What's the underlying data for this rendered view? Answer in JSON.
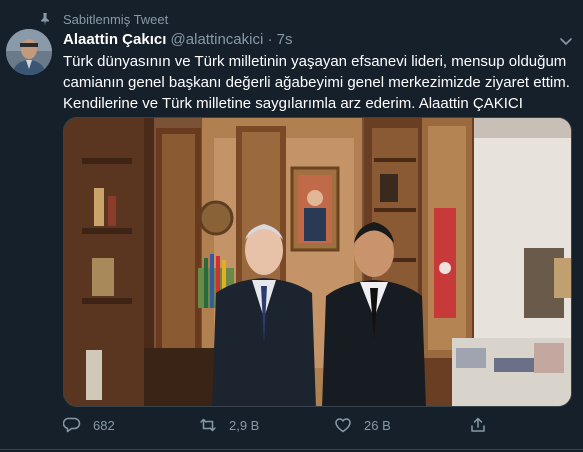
{
  "pinned": {
    "label": "Sabitlenmiş Tweet"
  },
  "author": {
    "name": "Alaattin Çakıcı",
    "handle": "@alattincakici",
    "separator": "·",
    "time": "7s"
  },
  "tweet": {
    "lines": [
      "Türk dünyasının ve Türk milletinin yaşayan efsanevi lideri, mensup olduğum",
      "camianın genel başkanı değerli ağabeyimi genel merkezimizde ziyaret ettim.",
      "Kendilerine ve Türk milletine saygılarımla arz ederim. Alaattin ÇAKICI"
    ]
  },
  "actions": {
    "reply_count": "682",
    "retweet_count": "2,9 B",
    "like_count": "26 B"
  },
  "colors": {
    "background": "#15202b",
    "muted": "#8899a6",
    "border": "#38444d"
  }
}
